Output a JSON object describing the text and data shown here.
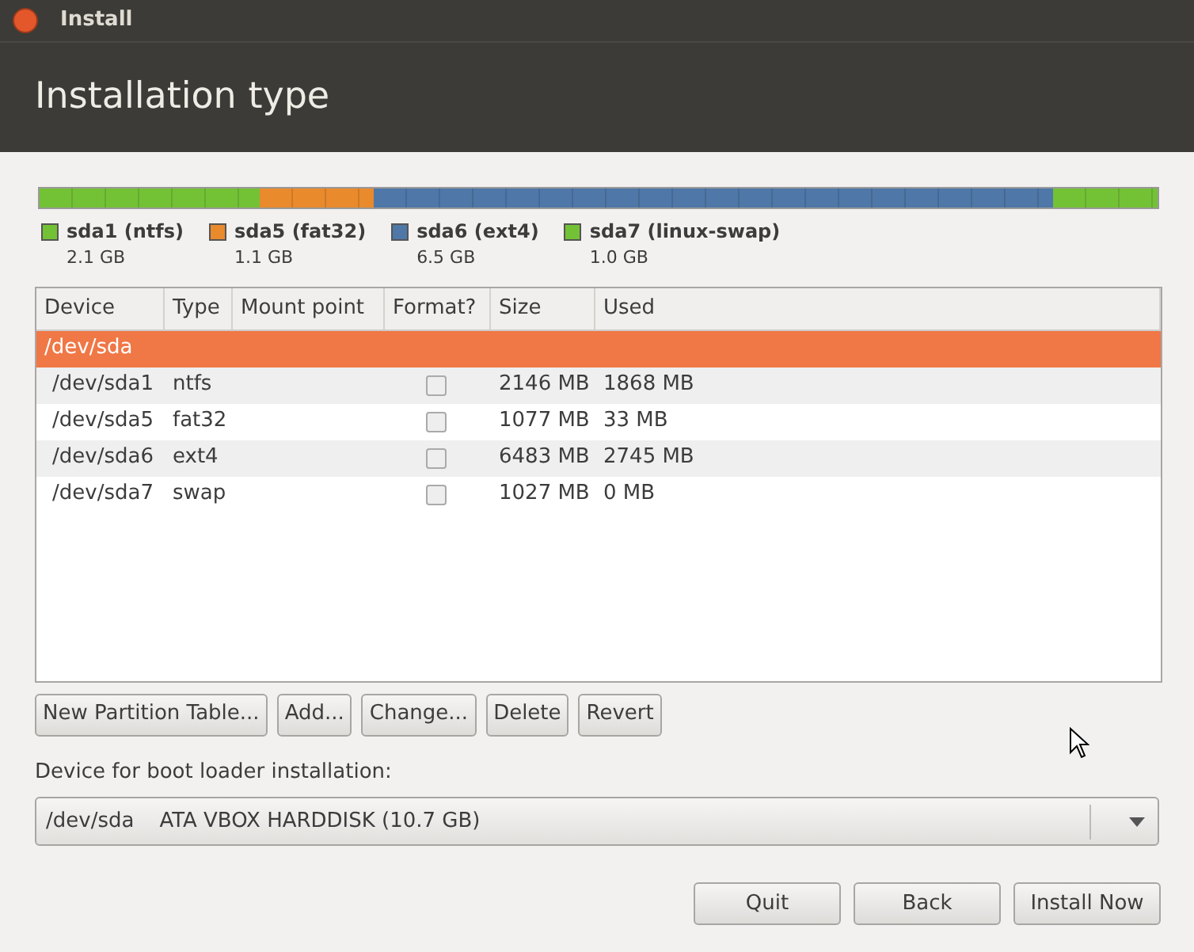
{
  "window": {
    "title": "Install"
  },
  "header": {
    "title": "Installation type"
  },
  "partition_bar": [
    {
      "name": "sda1 (ntfs)",
      "size": "2.1 GB",
      "color": "#73c236"
    },
    {
      "name": "sda5 (fat32)",
      "size": "1.1 GB",
      "color": "#e98a2c"
    },
    {
      "name": "sda6 (ext4)",
      "size": "6.5 GB",
      "color": "#4f77a8"
    },
    {
      "name": "sda7 (linux-swap)",
      "size": "1.0 GB",
      "color": "#73c236"
    }
  ],
  "table": {
    "columns": [
      "Device",
      "Type",
      "Mount point",
      "Format?",
      "Size",
      "Used"
    ],
    "rows": [
      {
        "kind": "disk",
        "device": "/dev/sda",
        "selected": true
      },
      {
        "kind": "partition",
        "device": "/dev/sda1",
        "type": "ntfs",
        "format": false,
        "size": "2146 MB",
        "used": "1868 MB",
        "selected": false
      },
      {
        "kind": "partition",
        "device": "/dev/sda5",
        "type": "fat32",
        "format": false,
        "size": "1077 MB",
        "used": "33 MB",
        "selected": false
      },
      {
        "kind": "partition",
        "device": "/dev/sda6",
        "type": "ext4",
        "format": false,
        "size": "6483 MB",
        "used": "2745 MB",
        "selected": false
      },
      {
        "kind": "partition",
        "device": "/dev/sda7",
        "type": "swap",
        "format": false,
        "size": "1027 MB",
        "used": "0 MB",
        "selected": false
      }
    ]
  },
  "table_buttons": [
    "New Partition Table...",
    "Add...",
    "Change...",
    "Delete",
    "Revert"
  ],
  "boot_loader": {
    "label": "Device for boot loader installation:",
    "device": "/dev/sda",
    "description": "ATA VBOX HARDDISK (10.7 GB)"
  },
  "buttons": [
    "Quit",
    "Back",
    "Install Now"
  ]
}
